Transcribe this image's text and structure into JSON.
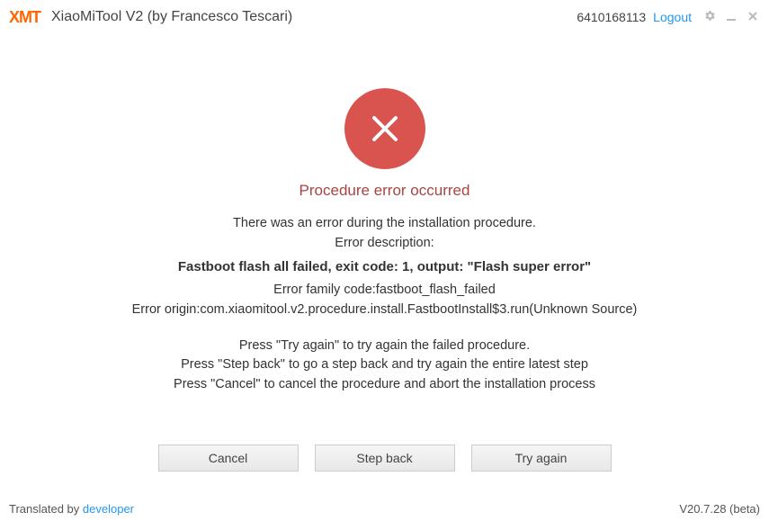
{
  "titlebar": {
    "logo_text": "XMT",
    "app_title": "XiaoMiTool V2 (by Francesco Tescari)",
    "user_id": "6410168113",
    "logout_label": "Logout"
  },
  "error": {
    "heading": "Procedure error occurred",
    "line1": "There was an error during the installation procedure.",
    "line2": "Error description:",
    "main": "Fastboot flash all failed, exit code: 1, output: \"Flash super error\"",
    "family": "Error family code:fastboot_flash_failed",
    "origin": "Error origin:com.xiaomitool.v2.procedure.install.FastbootInstall$3.run(Unknown Source)",
    "instr1": "Press \"Try again\" to try again the failed procedure.",
    "instr2": "Press \"Step back\" to go a step back and try again the entire latest step",
    "instr3": "Press \"Cancel\" to cancel the procedure and abort the installation process"
  },
  "buttons": {
    "cancel": "Cancel",
    "step_back": "Step back",
    "try_again": "Try again"
  },
  "footer": {
    "translated_prefix": "Translated by ",
    "translated_link": "developer",
    "version": "V20.7.28 (beta)"
  }
}
